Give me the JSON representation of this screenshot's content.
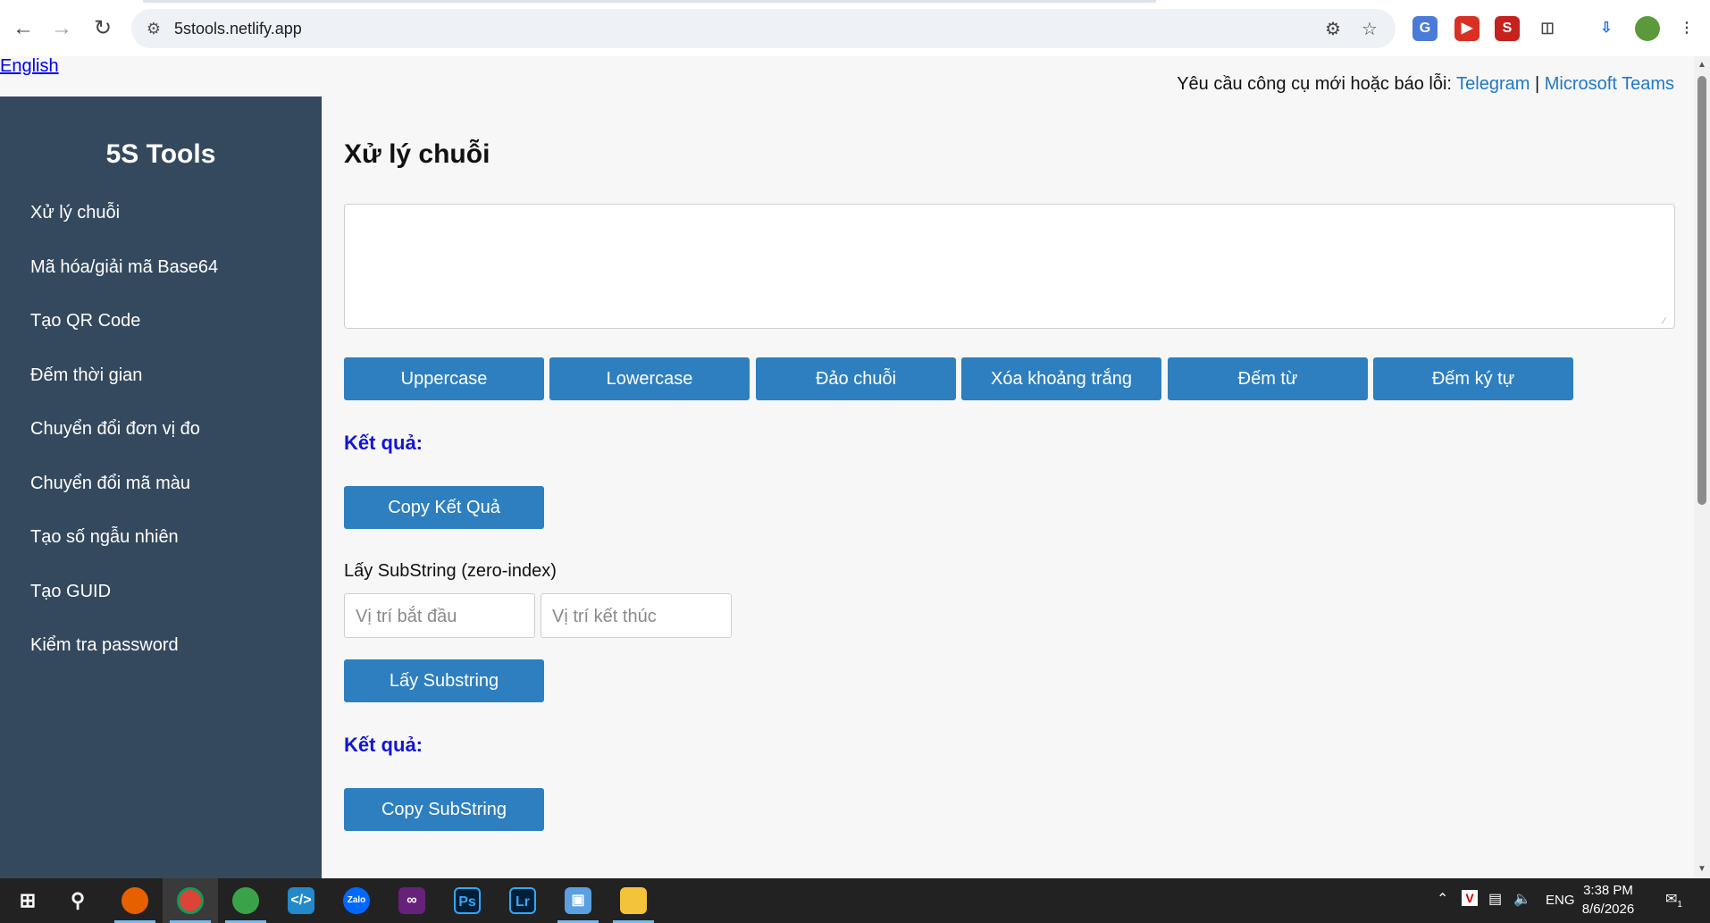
{
  "browser": {
    "url": "5stools.netlify.app",
    "back_icon": "arrow-left-icon",
    "forward_icon": "arrow-right-icon",
    "reload_icon": "reload-icon"
  },
  "page": {
    "lang_link": "English",
    "report": {
      "text": "Yêu cầu công cụ mới hoặc báo lỗi:",
      "telegram": "Telegram",
      "separator": "|",
      "teams": "Microsoft Teams"
    },
    "sidebar": {
      "brand": "5S Tools",
      "items": [
        {
          "label": "Xử lý chuỗi"
        },
        {
          "label": "Mã hóa/giải mã Base64"
        },
        {
          "label": "Tạo QR Code"
        },
        {
          "label": "Đếm thời gian"
        },
        {
          "label": "Chuyển đổi đơn vị đo"
        },
        {
          "label": "Chuyển đổi mã màu"
        },
        {
          "label": "Tạo số ngẫu nhiên"
        },
        {
          "label": "Tạo GUID"
        },
        {
          "label": "Kiểm tra password"
        }
      ]
    },
    "main": {
      "title": "Xử lý chuỗi",
      "textarea_value": "",
      "buttons": [
        {
          "label": "Uppercase"
        },
        {
          "label": "Lowercase"
        },
        {
          "label": "Đảo chuỗi"
        },
        {
          "label": "Xóa khoảng trắng"
        },
        {
          "label": "Đếm từ"
        },
        {
          "label": "Đếm ký tự"
        }
      ],
      "result_label": "Kết quả:",
      "copy_result": "Copy Kết Quả",
      "substring_label": "Lấy SubString (zero-index)",
      "start_placeholder": "Vị trí bắt đầu",
      "end_placeholder": "Vị trí kết thúc",
      "get_substring": "Lấy Substring",
      "result_label_2": "Kết quả:",
      "copy_substring": "Copy SubString"
    }
  },
  "taskbar": {
    "language": "ENG",
    "time": "3:38 PM",
    "date": "8/6/2026",
    "notification_count": "1"
  },
  "colors": {
    "sidebar": "#34495e",
    "button": "#2e7fbf",
    "result_label": "#1414d4",
    "link": "#1f78c8"
  }
}
